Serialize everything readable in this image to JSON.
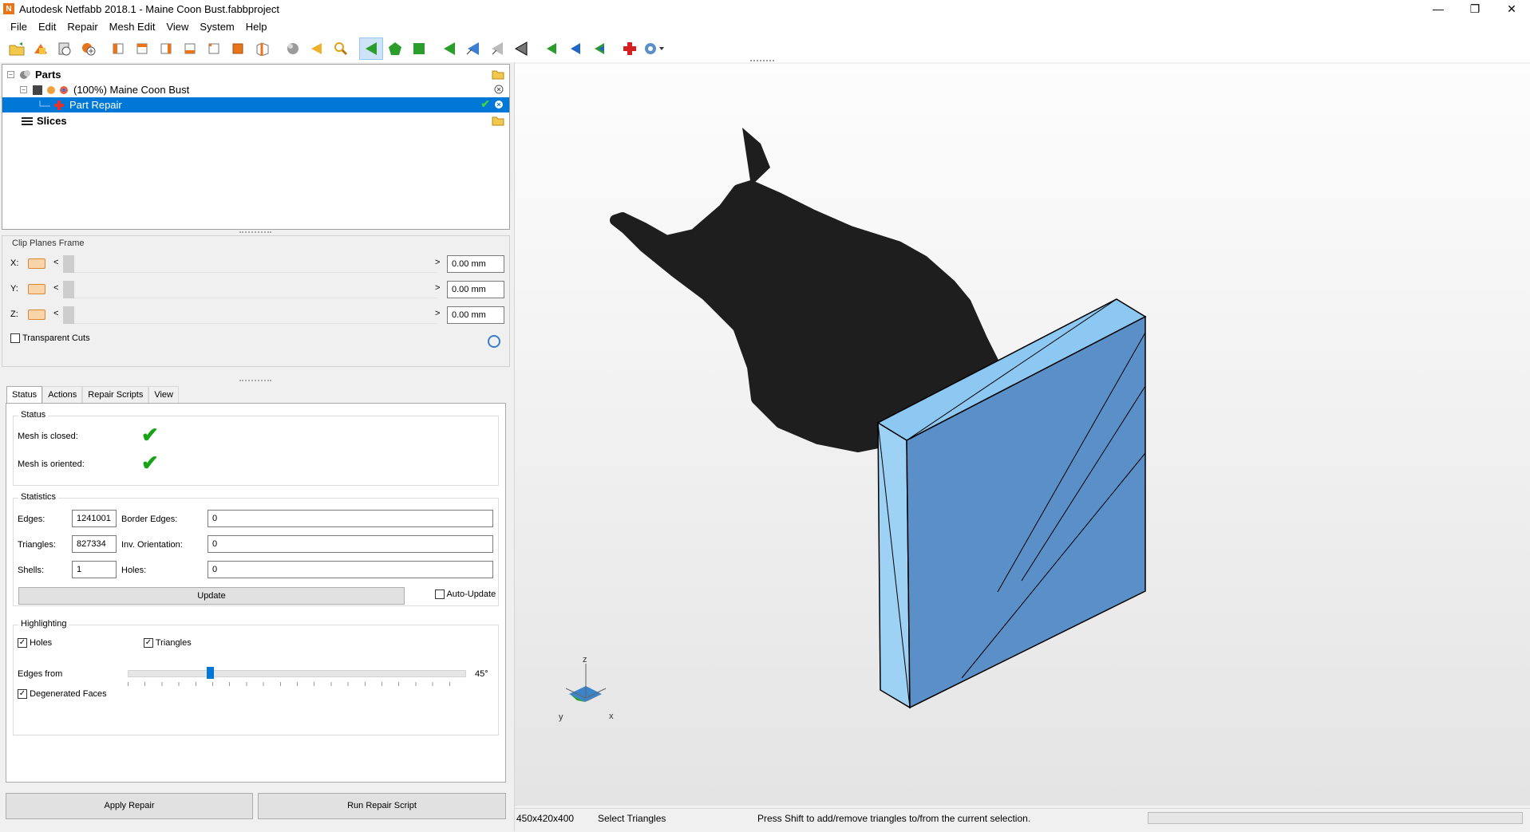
{
  "window": {
    "title": "Autodesk Netfabb 2018.1 - Maine Coon Bust.fabbproject",
    "app_icon_letter": "N"
  },
  "menu": [
    "File",
    "Edit",
    "Repair",
    "Mesh Edit",
    "View",
    "System",
    "Help"
  ],
  "toolbar_icons": [
    "open-project-icon",
    "import-part-icon",
    "add-part-icon",
    "add-part-plus-icon",
    "view-front-icon",
    "view-back-icon",
    "view-left-icon",
    "view-right-icon",
    "view-top-icon",
    "view-bottom-icon",
    "view-iso-icon",
    "sphere-icon",
    "arrow-left-icon",
    "zoom-icon",
    "select-triangle-icon",
    "select-surface-icon",
    "select-shell-icon",
    "select-add-icon",
    "select-remove-icon",
    "select-invert-icon",
    "select-all-icon",
    "nav-back-icon",
    "nav-forward-icon",
    "nav-reset-icon",
    "repair-cross-icon",
    "settings-dropdown-icon"
  ],
  "tree": {
    "parts_label": "Parts",
    "part_name": "(100%) Maine Coon Bust",
    "repair_label": "Part Repair",
    "slices_label": "Slices"
  },
  "clip": {
    "title": "Clip Planes Frame",
    "rows": [
      {
        "axis": "X:",
        "value": "0.00 mm"
      },
      {
        "axis": "Y:",
        "value": "0.00 mm"
      },
      {
        "axis": "Z:",
        "value": "0.00 mm"
      }
    ],
    "transparent_label": "Transparent Cuts",
    "transparent_checked": false
  },
  "tabs": [
    "Status",
    "Actions",
    "Repair Scripts",
    "View"
  ],
  "active_tab": "Status",
  "status": {
    "group_title": "Status",
    "mesh_closed_label": "Mesh is closed:",
    "mesh_oriented_label": "Mesh is oriented:",
    "check_glyph": "✔"
  },
  "statistics": {
    "group_title": "Statistics",
    "edges_label": "Edges:",
    "edges": "1241001",
    "triangles_label": "Triangles:",
    "triangles": "827334",
    "shells_label": "Shells:",
    "shells": "1",
    "border_edges_label": "Border Edges:",
    "border_edges": "0",
    "inv_orientation_label": "Inv. Orientation:",
    "inv_orientation": "0",
    "holes_label": "Holes:",
    "holes": "0",
    "update_label": "Update",
    "auto_update_label": "Auto-Update",
    "auto_update_checked": false
  },
  "highlighting": {
    "group_title": "Highlighting",
    "holes_label": "Holes",
    "holes_checked": true,
    "triangles_label": "Triangles",
    "triangles_checked": true,
    "edges_from_label": "Edges from",
    "edges_from_value": "45°",
    "degenerated_label": "Degenerated Faces",
    "degenerated_checked": true
  },
  "buttons": {
    "apply_repair": "Apply Repair",
    "run_repair_script": "Run Repair Script"
  },
  "viewport": {
    "axis_labels": {
      "z": "z",
      "y": "y",
      "x": "x"
    },
    "model_color": "#1e1e1e",
    "box_color": "#5a8fc8",
    "box_top_color": "#8cc8f2"
  },
  "statusbar": {
    "dimensions": "450x420x400",
    "mode": "Select Triangles",
    "hint": "Press Shift to add/remove triangles to/from the current selection."
  }
}
